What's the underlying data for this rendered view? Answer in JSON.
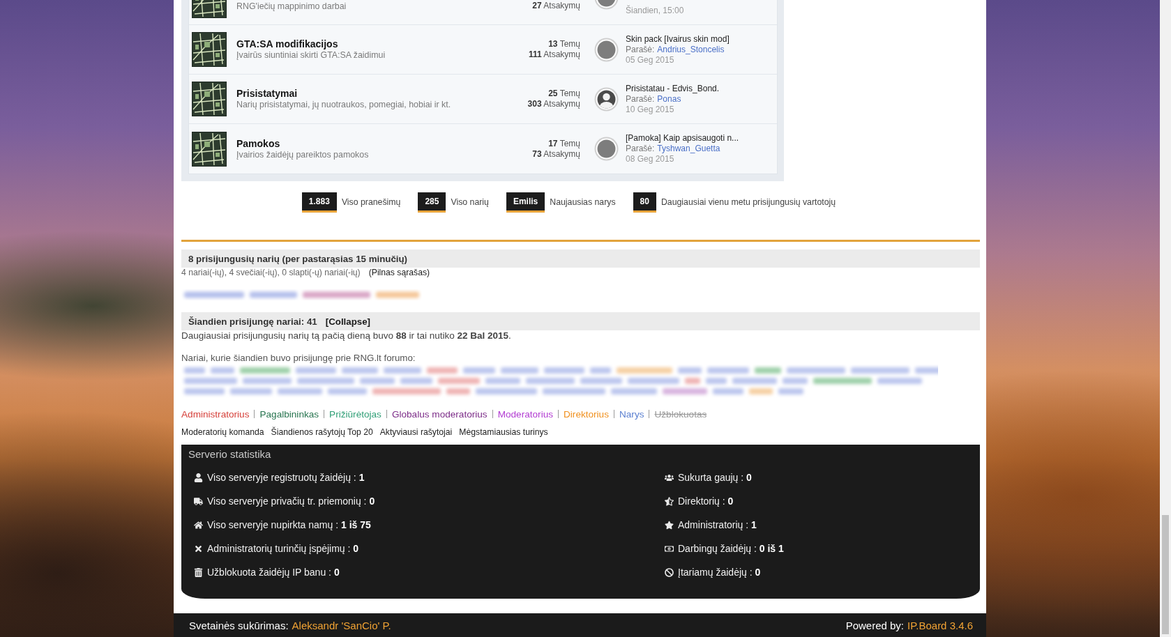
{
  "forums": [
    {
      "description": "RNG'iečių mappinimo darbai",
      "replies": "**27** Atsakymų",
      "last_post": {
        "date": "Šiandien, 15:00",
        "avatar": {
          "kind": "photo"
        }
      }
    },
    {
      "title": "GTA:SA modifikacijos",
      "description": "Įvairūs siuntiniai skirti GTA:SA žaidimui",
      "topics": "**13** Temų",
      "replies": "**111** Atsakymų",
      "last_post": {
        "topic": "Skin pack [Ivairus skin mod]",
        "author_label": "Parašė:",
        "author": "Andrius_Stoncelis",
        "date": "05 Geg 2015",
        "avatar": {
          "kind": "photo"
        }
      }
    },
    {
      "title": "Prisistatymai",
      "description": "Narių prisistatymai, jų nuotraukos, pomegiai, hobiai ir kt.",
      "topics": "**25** Temų",
      "replies": "**303** Atsakymų",
      "last_post": {
        "topic": "Prisistatau - Edvis_Bond.",
        "author_label": "Parašė:",
        "author": "Ponas",
        "date": "10 Geg 2015",
        "avatar": {
          "kind": "default"
        }
      }
    },
    {
      "title": "Pamokos",
      "description": "Įvairios žaidėjų pareiktos pamokos",
      "topics": "**17** Temų",
      "replies": "**73** Atsakymų",
      "last_post": {
        "topic": "[Pamoka] Kaip apsisaugoti n...",
        "author_label": "Parašė:",
        "author": "Tyshwan_Guetta",
        "date": "08 Geg 2015",
        "avatar": {
          "kind": "photo"
        }
      }
    }
  ],
  "board_stats": [
    {
      "value": "1.883",
      "label": "Viso pranešimų"
    },
    {
      "value": "285",
      "label": "Viso narių"
    },
    {
      "value": "Emilis",
      "label": "Naujausias narys"
    },
    {
      "value": "80",
      "label": "Daugiausiai vienu metu prisijungusių vartotojų"
    }
  ],
  "online_now": {
    "title": "8 prisijungusių narių (per pastarąsias 15 minučių)",
    "breakdown": "4 nariai(-ių), 4 svečiai(-ių), 0 slapti(-ų) nariai(-ių)",
    "full_list_link": "(Pilnas sąrašas)"
  },
  "today": {
    "title": "Šiandien prisijungę nariai: 41",
    "toggle": "[Collapse]",
    "record": "Daugiausiai prisijungusių narių tą pačią dieną buvo **88** ir tai nutiko **22 Bal 2015**.",
    "members_intro": "Nariai, kurie šiandien buvo prisijungę prie RNG.lt forumo:"
  },
  "groups": [
    {
      "label": "Administratorius",
      "color": "#d6403a",
      "struck": false
    },
    {
      "label": "Pagalbininkas",
      "color": "#27744f",
      "struck": false
    },
    {
      "label": "Prižiūrėtojas",
      "color": "#32a078",
      "struck": false
    },
    {
      "label": "Globalus moderatorius",
      "color": "#7c2c88",
      "struck": false
    },
    {
      "label": "Moderatorius",
      "color": "#b23bd2",
      "struck": false
    },
    {
      "label": "Direktorius",
      "color": "#f0901e",
      "struck": false
    },
    {
      "label": "Narys",
      "color": "#5a7fd0",
      "struck": false
    },
    {
      "label": "Užblokuotas",
      "color": "#999999",
      "struck": true
    }
  ],
  "links": [
    "Moderatorių komanda",
    "Šiandienos rašytojų Top 20",
    "Aktyviausi rašytojai",
    "Mėgstamiausias turinys"
  ],
  "server_stats": {
    "title": "Serverio statistika",
    "left": [
      "Viso serveryje registruotų žaidėjų : **1**",
      "Viso serveryje privačių tr. priemonių : **0**",
      "Viso serveryje nupirkta namų : **1 iš 75**",
      "Administratorių turinčių įspėjimų : **0**",
      "Užblokuota žaidėjų IP banu : **0**"
    ],
    "right": [
      "Sukurta gaujų : **0**",
      "Direktorių : **0**",
      "Administratorių : **1**",
      "Darbingų žaidėjų : **0 iš 1**",
      "Įtariamų žaidėjų : **0**"
    ]
  },
  "footer": {
    "credit_label": "Svetainės sukūrimas:",
    "credit_link": "Aleksandr 'SanCio' P.",
    "powered_label": "Powered by:",
    "powered_link": "IP.Board 3.4.6"
  }
}
